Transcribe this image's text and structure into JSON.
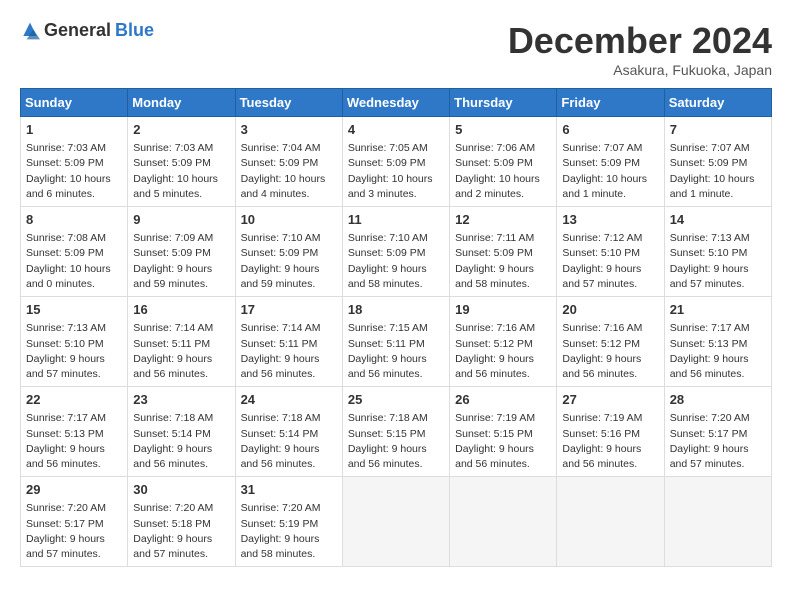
{
  "header": {
    "logo_general": "General",
    "logo_blue": "Blue",
    "month": "December 2024",
    "location": "Asakura, Fukuoka, Japan"
  },
  "days_of_week": [
    "Sunday",
    "Monday",
    "Tuesday",
    "Wednesday",
    "Thursday",
    "Friday",
    "Saturday"
  ],
  "weeks": [
    [
      {
        "day": 1,
        "info": "Sunrise: 7:03 AM\nSunset: 5:09 PM\nDaylight: 10 hours and 6 minutes."
      },
      {
        "day": 2,
        "info": "Sunrise: 7:03 AM\nSunset: 5:09 PM\nDaylight: 10 hours and 5 minutes."
      },
      {
        "day": 3,
        "info": "Sunrise: 7:04 AM\nSunset: 5:09 PM\nDaylight: 10 hours and 4 minutes."
      },
      {
        "day": 4,
        "info": "Sunrise: 7:05 AM\nSunset: 5:09 PM\nDaylight: 10 hours and 3 minutes."
      },
      {
        "day": 5,
        "info": "Sunrise: 7:06 AM\nSunset: 5:09 PM\nDaylight: 10 hours and 2 minutes."
      },
      {
        "day": 6,
        "info": "Sunrise: 7:07 AM\nSunset: 5:09 PM\nDaylight: 10 hours and 1 minute."
      },
      {
        "day": 7,
        "info": "Sunrise: 7:07 AM\nSunset: 5:09 PM\nDaylight: 10 hours and 1 minute."
      }
    ],
    [
      {
        "day": 8,
        "info": "Sunrise: 7:08 AM\nSunset: 5:09 PM\nDaylight: 10 hours and 0 minutes."
      },
      {
        "day": 9,
        "info": "Sunrise: 7:09 AM\nSunset: 5:09 PM\nDaylight: 9 hours and 59 minutes."
      },
      {
        "day": 10,
        "info": "Sunrise: 7:10 AM\nSunset: 5:09 PM\nDaylight: 9 hours and 59 minutes."
      },
      {
        "day": 11,
        "info": "Sunrise: 7:10 AM\nSunset: 5:09 PM\nDaylight: 9 hours and 58 minutes."
      },
      {
        "day": 12,
        "info": "Sunrise: 7:11 AM\nSunset: 5:09 PM\nDaylight: 9 hours and 58 minutes."
      },
      {
        "day": 13,
        "info": "Sunrise: 7:12 AM\nSunset: 5:10 PM\nDaylight: 9 hours and 57 minutes."
      },
      {
        "day": 14,
        "info": "Sunrise: 7:13 AM\nSunset: 5:10 PM\nDaylight: 9 hours and 57 minutes."
      }
    ],
    [
      {
        "day": 15,
        "info": "Sunrise: 7:13 AM\nSunset: 5:10 PM\nDaylight: 9 hours and 57 minutes."
      },
      {
        "day": 16,
        "info": "Sunrise: 7:14 AM\nSunset: 5:11 PM\nDaylight: 9 hours and 56 minutes."
      },
      {
        "day": 17,
        "info": "Sunrise: 7:14 AM\nSunset: 5:11 PM\nDaylight: 9 hours and 56 minutes."
      },
      {
        "day": 18,
        "info": "Sunrise: 7:15 AM\nSunset: 5:11 PM\nDaylight: 9 hours and 56 minutes."
      },
      {
        "day": 19,
        "info": "Sunrise: 7:16 AM\nSunset: 5:12 PM\nDaylight: 9 hours and 56 minutes."
      },
      {
        "day": 20,
        "info": "Sunrise: 7:16 AM\nSunset: 5:12 PM\nDaylight: 9 hours and 56 minutes."
      },
      {
        "day": 21,
        "info": "Sunrise: 7:17 AM\nSunset: 5:13 PM\nDaylight: 9 hours and 56 minutes."
      }
    ],
    [
      {
        "day": 22,
        "info": "Sunrise: 7:17 AM\nSunset: 5:13 PM\nDaylight: 9 hours and 56 minutes."
      },
      {
        "day": 23,
        "info": "Sunrise: 7:18 AM\nSunset: 5:14 PM\nDaylight: 9 hours and 56 minutes."
      },
      {
        "day": 24,
        "info": "Sunrise: 7:18 AM\nSunset: 5:14 PM\nDaylight: 9 hours and 56 minutes."
      },
      {
        "day": 25,
        "info": "Sunrise: 7:18 AM\nSunset: 5:15 PM\nDaylight: 9 hours and 56 minutes."
      },
      {
        "day": 26,
        "info": "Sunrise: 7:19 AM\nSunset: 5:15 PM\nDaylight: 9 hours and 56 minutes."
      },
      {
        "day": 27,
        "info": "Sunrise: 7:19 AM\nSunset: 5:16 PM\nDaylight: 9 hours and 56 minutes."
      },
      {
        "day": 28,
        "info": "Sunrise: 7:20 AM\nSunset: 5:17 PM\nDaylight: 9 hours and 57 minutes."
      }
    ],
    [
      {
        "day": 29,
        "info": "Sunrise: 7:20 AM\nSunset: 5:17 PM\nDaylight: 9 hours and 57 minutes."
      },
      {
        "day": 30,
        "info": "Sunrise: 7:20 AM\nSunset: 5:18 PM\nDaylight: 9 hours and 57 minutes."
      },
      {
        "day": 31,
        "info": "Sunrise: 7:20 AM\nSunset: 5:19 PM\nDaylight: 9 hours and 58 minutes."
      },
      null,
      null,
      null,
      null
    ]
  ]
}
